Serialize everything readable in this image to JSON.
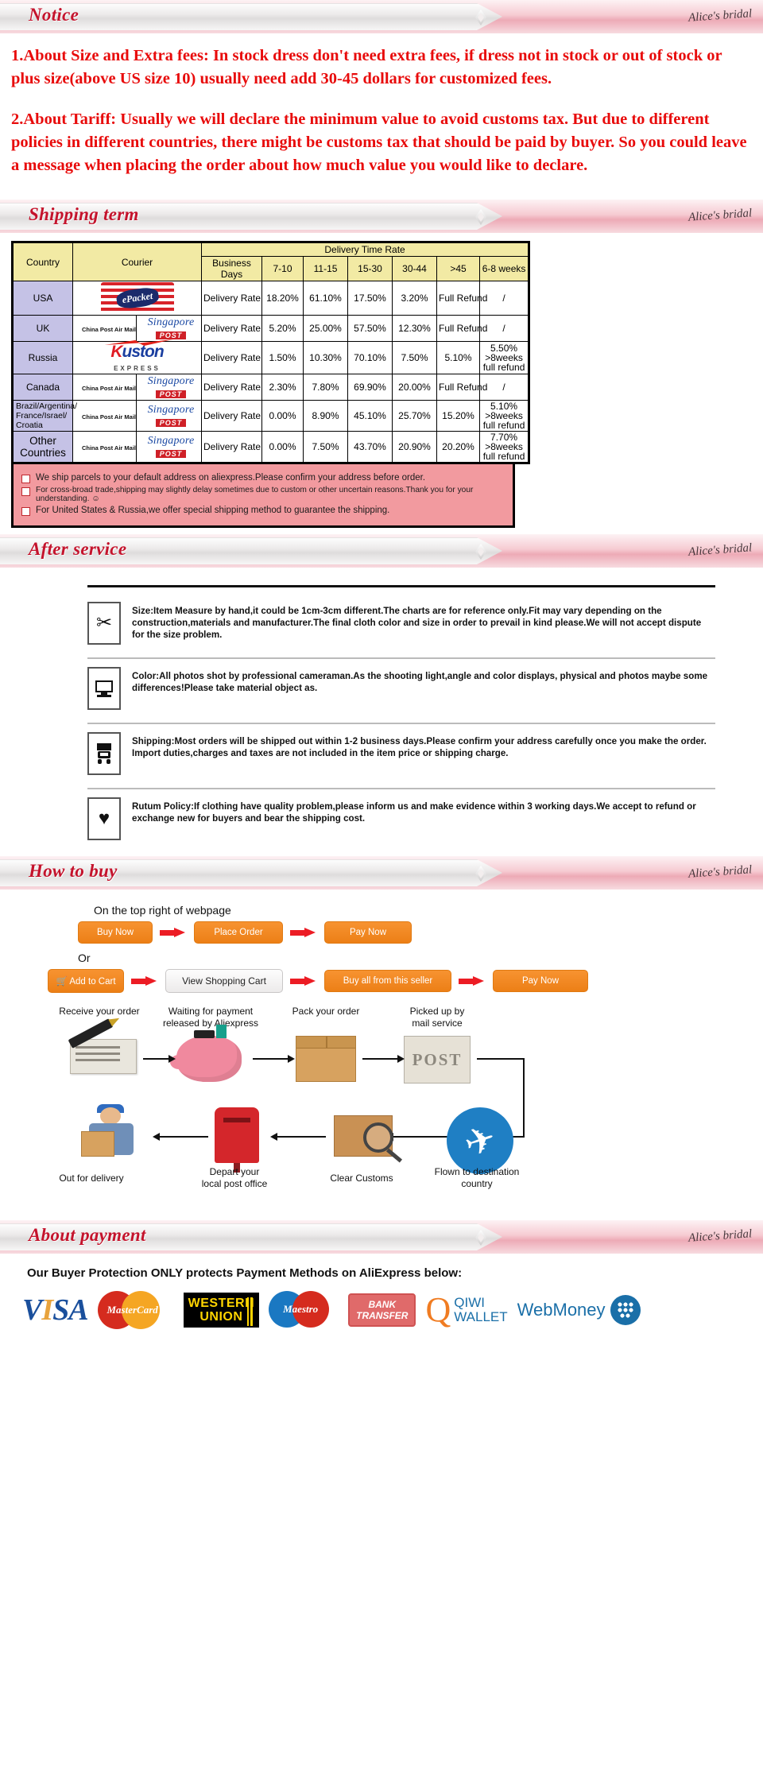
{
  "brand": "Alice's bridal",
  "sections": {
    "notice": {
      "title": "Notice"
    },
    "shipping": {
      "title": "Shipping term"
    },
    "after_service": {
      "title": "After service"
    },
    "how_to_buy": {
      "title": "How to buy"
    },
    "about_payment": {
      "title": "About payment"
    }
  },
  "notice": {
    "p1": "1.About Size and Extra fees: In stock dress don't need extra fees, if dress not in stock or out of stock or plus size(above US size 10) usually need add 30-45 dollars for customized fees.",
    "p2": "2.About Tariff: Usually we will declare the minimum value to avoid customs tax. But due to different policies in different countries, there might be customs tax that should be paid by buyer. So you could leave a message when placing the order about how much value you would like to declare."
  },
  "shipping_table": {
    "headers": {
      "country": "Country",
      "courier": "Courier",
      "delivery_time_rate": "Delivery Time Rate",
      "business_days": "Business Days",
      "ranges": [
        "7-10",
        "11-15",
        "15-30",
        "30-44",
        ">45",
        "6-8 weeks"
      ]
    },
    "rate_label": "Delivery Rate",
    "rows": [
      {
        "country": "USA",
        "couriers": [
          "ePacket"
        ],
        "values": [
          "18.20%",
          "61.10%",
          "17.50%",
          "3.20%",
          "Full Refund",
          "/"
        ]
      },
      {
        "country": "UK",
        "couriers": [
          "China Post Air Mail",
          "Singapore POST"
        ],
        "values": [
          "5.20%",
          "25.00%",
          "57.50%",
          "12.30%",
          "Full Refund",
          "/"
        ]
      },
      {
        "country": "Russia",
        "couriers": [
          "Kuston EXPRESS"
        ],
        "values": [
          "1.50%",
          "10.30%",
          "70.10%",
          "7.50%",
          "5.10%",
          "5.50%\n>8weeks\nfull refund"
        ]
      },
      {
        "country": "Canada",
        "couriers": [
          "China Post Air Mail",
          "Singapore POST"
        ],
        "values": [
          "2.30%",
          "7.80%",
          "69.90%",
          "20.00%",
          "Full Refund",
          "/"
        ]
      },
      {
        "country": "Brazil/Argentina/\nFrance/Israel/\nCroatia",
        "couriers": [
          "China Post Air Mail",
          "Singapore POST"
        ],
        "values": [
          "0.00%",
          "8.90%",
          "45.10%",
          "25.70%",
          "15.20%",
          "5.10%\n>8weeks\nfull refund"
        ]
      },
      {
        "country": "Other Countries",
        "couriers": [
          "China Post Air Mail",
          "Singapore POST"
        ],
        "values": [
          "0.00%",
          "7.50%",
          "43.70%",
          "20.90%",
          "20.20%",
          "7.70%\n>8weeks\nfull refund"
        ]
      }
    ]
  },
  "shipping_notes": [
    "We ship parcels to your default address on aliexpress.Please confirm your address before order.",
    "For cross-broad trade,shipping may slightly delay sometimes due to custom or other uncertain reasons.Thank you for your understanding.  ☺",
    "For United States & Russia,we offer special shipping method to guarantee the shipping."
  ],
  "after_service": [
    {
      "icon": "scissors-icon",
      "glyph": "✂",
      "text": "Size:Item Measure by hand,it could be 1cm-3cm different.The charts are for reference only.Fit may vary depending on the construction,materials and manufacturer.The final cloth color and size in order to prevail in kind please.We will not accept dispute for the size problem."
    },
    {
      "icon": "monitor-icon",
      "glyph": "⎙",
      "text": "Color:All photos shot by professional cameraman.As the shooting light,angle and color displays, physical and photos maybe some differences!Please take material object as."
    },
    {
      "icon": "truck-icon",
      "glyph": "⬛",
      "text": "Shipping:Most orders will be shipped out within 1-2 business days.Please confirm your address carefully once you make the order.\nImport duties,charges and taxes are not included in the item price or shipping charge."
    },
    {
      "icon": "heart-icon",
      "glyph": "♥",
      "text": "Rutum Policy:If clothing have quality problem,please inform us and make evidence within 3 working days.We accept to refund or exchange new for buyers and bear the shipping cost."
    }
  ],
  "how_to_buy": {
    "lead": "On the top right of webpage",
    "or": "Or",
    "flow_a": [
      "Buy Now",
      "Place Order",
      "Pay Now"
    ],
    "flow_b": [
      "🛒 Add to Cart",
      "View Shopping Cart",
      "Buy all from this seller",
      "Pay Now"
    ],
    "diagram": [
      {
        "label": "Receive your order",
        "icon": "envelope-pen-icon"
      },
      {
        "label": "Waiting for payment\nreleased by Aliexpress",
        "icon": "piggy-bank-icon"
      },
      {
        "label": "Pack your order",
        "icon": "parcel-box-icon"
      },
      {
        "label": "Picked up by\nmail service",
        "icon": "post-box-icon"
      },
      {
        "label": "Flown to destination\ncountry",
        "icon": "airplane-icon"
      },
      {
        "label": "Clear Customs",
        "icon": "magnifier-box-icon"
      },
      {
        "label": "Depart your\nlocal post office",
        "icon": "mailbox-icon"
      },
      {
        "label": "Out for delivery",
        "icon": "courier-icon"
      }
    ]
  },
  "payment": {
    "headline": "Our Buyer Protection ONLY protects Payment Methods on AliExpress below:",
    "methods": [
      {
        "name": "VISA",
        "icon": "visa-logo"
      },
      {
        "name": "MasterCard",
        "icon": "mastercard-logo"
      },
      {
        "name": "WESTERN UNION",
        "icon": "western-union-logo"
      },
      {
        "name": "Maestro",
        "icon": "maestro-logo"
      },
      {
        "name": "BANK TRANSFER",
        "icon": "bank-transfer-logo"
      },
      {
        "name": "QIWI WALLET",
        "icon": "qiwi-wallet-logo"
      },
      {
        "name": "WebMoney",
        "icon": "webmoney-logo"
      }
    ],
    "western_union_line1": "WESTERN",
    "western_union_line2": "UNION",
    "bank_line1": "BANK",
    "bank_line2": "TRANSFER",
    "qiwi_line1": "QIWI",
    "qiwi_line2": "WALLET",
    "webmoney": "WebMoney",
    "visa": "VISA",
    "mastercard": "MasterCard",
    "maestro": "Maestro"
  }
}
